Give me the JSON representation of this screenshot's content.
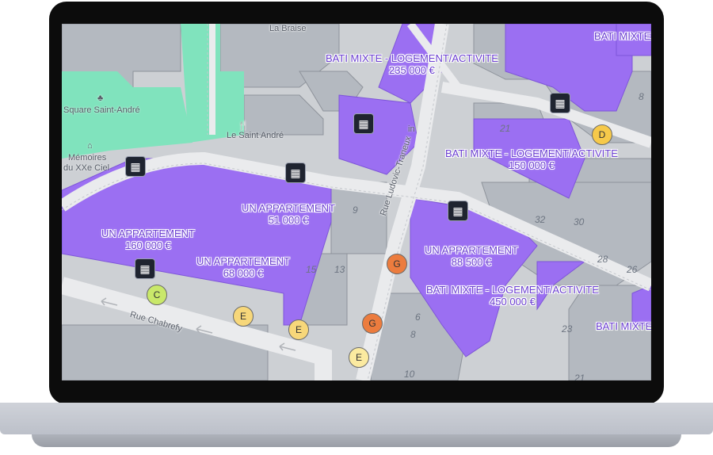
{
  "map": {
    "listings": [
      {
        "id": "l1",
        "type": "BATI MIXTE - LOGEMENT/ACTIVITE",
        "price": "235 000 €"
      },
      {
        "id": "l2",
        "type": "BATI MIXTE - LOGEMENT/ACTIVITE",
        "price": "150 000 €"
      },
      {
        "id": "l3",
        "type": "UN APPARTEMENT",
        "price": "51 000 €"
      },
      {
        "id": "l4",
        "type": "UN APPARTEMENT",
        "price": "160 000 €"
      },
      {
        "id": "l5",
        "type": "UN APPARTEMENT",
        "price": "68 000 €"
      },
      {
        "id": "l6",
        "type": "UN APPARTEMENT",
        "price": "88 500 €"
      },
      {
        "id": "l7",
        "type": "BATI MIXTE - LOGEMENT/ACTIVITE",
        "price": "450 000 €"
      },
      {
        "id": "l8",
        "type": "BATI MIXTE",
        "price": ""
      },
      {
        "id": "l9",
        "type": "BATI MIXTE",
        "price": ""
      }
    ],
    "energy_badges": [
      {
        "id": "b1",
        "grade": "D",
        "color": "#f6c94a"
      },
      {
        "id": "b2",
        "grade": "C",
        "color": "#c9e86a"
      },
      {
        "id": "b3",
        "grade": "E",
        "color": "#f7d77a"
      },
      {
        "id": "b4",
        "grade": "E",
        "color": "#f7d77a"
      },
      {
        "id": "b5",
        "grade": "G",
        "color": "#ec7c3e"
      },
      {
        "id": "b6",
        "grade": "G",
        "color": "#ec7c3e"
      },
      {
        "id": "b7",
        "grade": "E",
        "color": "#fbeaa0"
      }
    ],
    "streets": {
      "chabrefy": "Rue Chabrefy",
      "traneux": "Rue Ludovic-Traneux",
      "braise": "La Braise"
    },
    "pois": {
      "square": "Square Saint-André",
      "saint_andre": "Le Saint André",
      "memoires_1": "Mémoires",
      "memoires_2": "du XXe Ciel",
      "cut": "in"
    },
    "plot_numbers": [
      "8",
      "21",
      "9",
      "32",
      "30",
      "28",
      "26",
      "15",
      "13",
      "6",
      "8",
      "23",
      "21",
      "10"
    ],
    "colors": {
      "building_for_sale": "#9b6ff2",
      "building": "#b4b9c0",
      "park": "#80e3bd",
      "road": "#eaebed",
      "label": "#6b3fd0",
      "pin": "#1f2430"
    }
  }
}
